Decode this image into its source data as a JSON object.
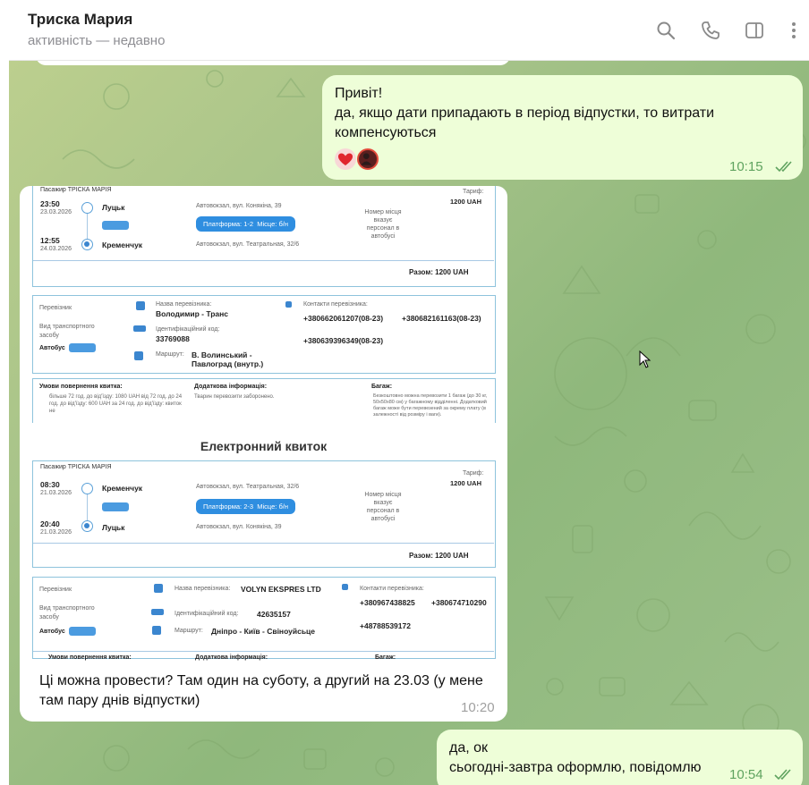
{
  "header": {
    "name": "Триска Мария",
    "status": "активність — недавно",
    "icons": [
      "search-icon",
      "phone-icon",
      "sidebar-icon",
      "more-icon"
    ]
  },
  "messages": {
    "out1": {
      "line1": "Привіт!",
      "line2": "да, якщо дати припадають в період відпустки, то витрати компенсуються",
      "time": "10:15",
      "reactions": [
        "heart",
        "avatar"
      ]
    },
    "in1": {
      "caption": "Ці можна провести? Там один на суботу, а другий на 23.03 (у мене там пару днів відпустки)",
      "time": "10:20"
    },
    "out2": {
      "line1": "да, ок",
      "line2": "сьогодні-завтра оформлю, повідомлю",
      "time": "10:54"
    }
  },
  "ticket1": {
    "passenger": "Пасажир ТРІСКА МАРІЯ",
    "dep_time": "23:50",
    "dep_date": "23.03.2026",
    "dep_city": "Луцьк",
    "dep_station": "Автовокзал, вул. Конякіна, 39",
    "arr_time": "12:55",
    "arr_date": "24.03.2026",
    "arr_city": "Кременчук",
    "arr_station": "Автовокзал, вул. Театральная, 32/6",
    "platform": "Платформа: 1-2",
    "seat": "Місце: б/н",
    "seat_note": "Номер місця вказує персонал в автобусі",
    "tariff_label": "Тариф:",
    "tariff": "1200 UAH",
    "total": "Разом: 1200 UAH",
    "carrier_label": "Перевізник",
    "transport_label": "Вид транспортного засобу",
    "transport": "Автобус",
    "carrier_name_label": "Назва перевізника:",
    "carrier_name": "Володимир - Транс",
    "id_label": "Ідентифікаційний код:",
    "id": "33769088",
    "route_label": "Маршрут:",
    "route": "В. Волинський - Павлоград (внутр.)",
    "contacts_label": "Контакти перевізника:",
    "phone1": "+380662061207(08-23)",
    "phone2": "+380682161163(08-23)",
    "phone3": "+380639396349(08-23)",
    "return_label": "Умови повернення квитка:",
    "return_text": "більше 72 год. до від'їзду: 1080 UAH від 72 год. до 24 год. до від'їзду: 600 UAH за 24 год. до від'їзду: квиток не",
    "extra_label": "Додаткова інформація:",
    "extra_text": "Тварин перевозити заборонено.",
    "baggage_label": "Багаж:",
    "baggage_text": "Безкоштовно можна перевозити 1 багаж (до 30 кг, 50х50х80 см) у багажному відділенні. Додатковий багаж може бути перевезений за окрему плату (в залежності від розміру і ваги)."
  },
  "ticket2": {
    "title": "Електронний квиток",
    "passenger": "Пасажир ТРІСКА МАРІЯ",
    "dep_time": "08:30",
    "dep_date": "21.03.2026",
    "dep_city": "Кременчук",
    "dep_station": "Автовокзал, вул. Театральная, 32/6",
    "arr_time": "20:40",
    "arr_date": "21.03.2026",
    "arr_city": "Луцьк",
    "arr_station": "Автовокзал, вул. Конякіна, 39",
    "platform": "Платформа: 2-3",
    "seat": "Місце: б/н",
    "seat_note": "Номер місця вказує персонал в автобусі",
    "tariff_label": "Тариф:",
    "tariff": "1200 UAH",
    "total": "Разом: 1200 UAH",
    "carrier_label": "Перевізник",
    "transport_label": "Вид транспортного засобу",
    "transport": "Автобус",
    "carrier_name_label": "Назва перевізника:",
    "carrier_name": "VOLYN EKSPRES LTD",
    "id_label": "Ідентифікаційний код:",
    "id": "42635157",
    "route_label": "Маршрут:",
    "route": "Дніпро - Київ - Свіноуйсьце",
    "contacts_label": "Контакти перевізника:",
    "phone1": "+380967438825",
    "phone2": "+380674710290",
    "phone3": "+48788539172",
    "return_label": "Умови повернення квитка:",
    "extra_label": "Додаткова інформація:",
    "baggage_label": "Багаж:"
  }
}
